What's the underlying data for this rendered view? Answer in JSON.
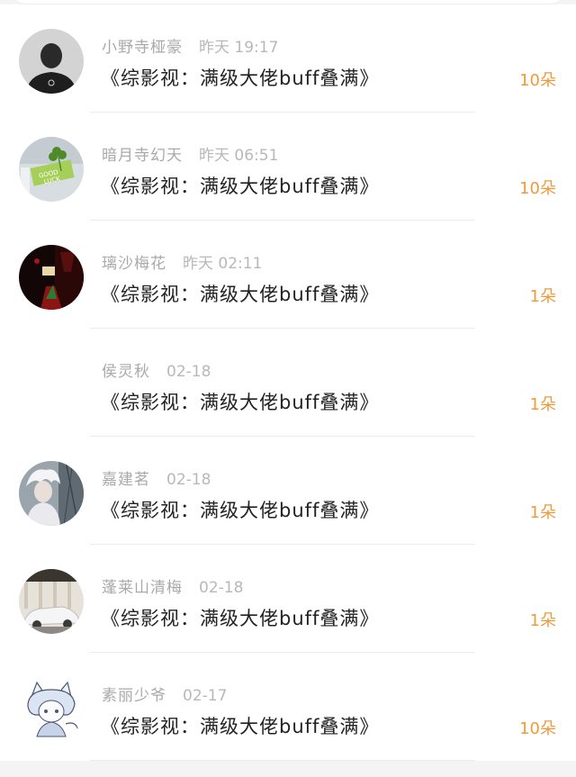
{
  "colors": {
    "background": "#f4f4f4",
    "row": "#ffffff",
    "name": "#a9a9a9",
    "title": "#222222",
    "amount": "#ef9a3c"
  },
  "rows": [
    {
      "name": "小野寺桠豪",
      "time": "昨天 19:17",
      "title": "《综影视：满级大佬buff叠满》",
      "amount": "10朵",
      "avatar": "dark-silhouette-avatar"
    },
    {
      "name": "暗月寺幻天",
      "time": "昨天 06:51",
      "title": "《综影视：满级大佬buff叠满》",
      "amount": "10朵",
      "avatar": "clover-good-luck-avatar"
    },
    {
      "name": "璃沙梅花",
      "time": "昨天 02:11",
      "title": "《综影视：满级大佬buff叠满》",
      "amount": "1朵",
      "avatar": "dark-red-photo-avatar"
    },
    {
      "name": "侯灵秋",
      "time": "02-18",
      "title": "《综影视：满级大佬buff叠满》",
      "amount": "1朵",
      "avatar": "blank-avatar"
    },
    {
      "name": "嘉建茗",
      "time": "02-18",
      "title": "《综影视：满级大佬buff叠满》",
      "amount": "1朵",
      "avatar": "white-hair-figure-avatar"
    },
    {
      "name": "蓬莱山清梅",
      "time": "02-18",
      "title": "《综影视：满级大佬buff叠满》",
      "amount": "1朵",
      "avatar": "white-car-avatar"
    },
    {
      "name": "素丽少爷",
      "time": "02-17",
      "title": "《综影视：满级大佬buff叠满》",
      "amount": "10朵",
      "avatar": "anime-cat-girl-avatar"
    }
  ]
}
